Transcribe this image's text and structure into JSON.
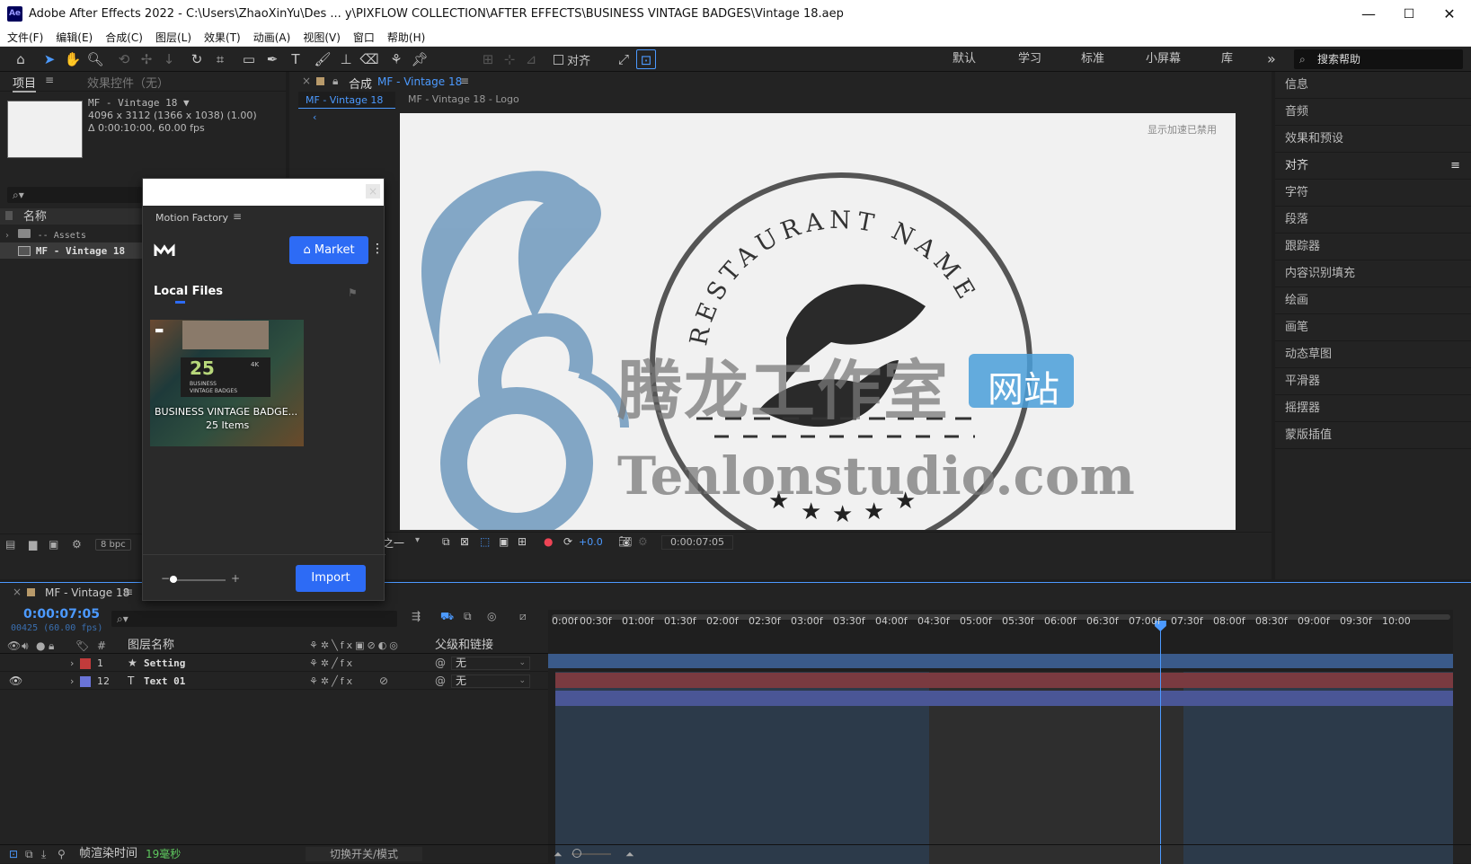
{
  "titlebar": {
    "app_icon": "Ae",
    "title": "Adobe After Effects 2022 - C:\\Users\\ZhaoXinYu\\Des ... y\\PIXFLOW COLLECTION\\AFTER EFFECTS\\BUSINESS VINTAGE BADGES\\Vintage 18.aep"
  },
  "menus": [
    "文件(F)",
    "编辑(E)",
    "合成(C)",
    "图层(L)",
    "效果(T)",
    "动画(A)",
    "视图(V)",
    "窗口",
    "帮助(H)"
  ],
  "toolbar": {
    "align_label": "对齐",
    "workspaces": [
      "默认",
      "学习",
      "标准",
      "小屏幕",
      "库"
    ],
    "more": "»",
    "help_placeholder": "搜索帮助"
  },
  "project": {
    "tab_project": "项目",
    "tab_effects": "效果控件（无）",
    "comp_name": "MF - Vintage 18 ▼",
    "comp_info1": "4096 x 3112 (1366 x 1038) (1.00)",
    "comp_info2": "Δ 0:00:10:00, 60.00 fps",
    "search_icon": "⌕▾",
    "col_name": "名称",
    "items": [
      {
        "label": "-- Assets",
        "type": "folder"
      },
      {
        "label": "MF - Vintage 18",
        "type": "comp"
      }
    ],
    "bpc": "8 bpc"
  },
  "motion_factory": {
    "title": "Motion Factory",
    "market_button": "Market",
    "local_files": "Local Files",
    "pack_title": "BUSINESS VINTAGE BADGE...",
    "pack_count": "25 Items",
    "thumb_big": "25",
    "thumb_line1": "BUSINESS",
    "thumb_line2": "VINTAGE BADGES",
    "thumb_4k": "4K",
    "import_button": "Import",
    "close": "×"
  },
  "composition": {
    "tab_close": "×",
    "panel_label": "合成",
    "comp_link": "MF - Vintage 18",
    "subtab_active": "MF - Vintage 18",
    "subtab_other": "MF - Vintage 18 - Logo",
    "accel_notice": "显示加速已禁用",
    "badge_text": "RESTAURANT NAME",
    "watermark_cn": "腾龙工作室",
    "watermark_site": "网站",
    "watermark_url": "Tenlonstudio.com",
    "zoom_label": "分之一",
    "exposure": "+0.0",
    "timecode": "0:00:07:05"
  },
  "right_panel": {
    "items": [
      "信息",
      "音频",
      "效果和预设",
      "对齐",
      "字符",
      "段落",
      "跟踪器",
      "内容识别填充",
      "绘画",
      "画笔",
      "动态草图",
      "平滑器",
      "摇摆器",
      "蒙版插值"
    ],
    "active_item": "对齐"
  },
  "timeline": {
    "tab_close": "×",
    "tab": "MF - Vintage 18",
    "timecode": "0:00:07:05",
    "frames": "00425 (60.00 fps)",
    "search_icon": "⌕▾",
    "col_layer_name": "图层名称",
    "col_number": "#",
    "col_parent": "父级和链接",
    "layers": [
      {
        "num": "1",
        "type_icon": "★",
        "name": "Setting",
        "parent": "无",
        "color": "#c23b3b",
        "bar_color": "#7a3a40"
      },
      {
        "num": "12",
        "type_icon": "T",
        "name": "Text 01",
        "parent": "无",
        "color": "#6a74d8",
        "bar_color": "#4a5696"
      }
    ],
    "ruler": [
      "0:00f",
      "00:30f",
      "01:00f",
      "01:30f",
      "02:00f",
      "02:30f",
      "03:00f",
      "03:30f",
      "04:00f",
      "04:30f",
      "05:00f",
      "05:30f",
      "06:00f",
      "06:30f",
      "07:00f",
      "07:30f",
      "08:00f",
      "08:30f",
      "09:00f",
      "09:30f",
      "10:00"
    ],
    "render_label": "帧渲染时间",
    "render_value": "19毫秒",
    "toggle_label": "切换开关/模式",
    "playhead_seconds": 7.083,
    "duration_seconds": 10
  },
  "colors": {
    "accent": "#2d6bf5",
    "bg": "#1d1d1d",
    "panel": "#232323",
    "timecode": "#4c9aff"
  }
}
